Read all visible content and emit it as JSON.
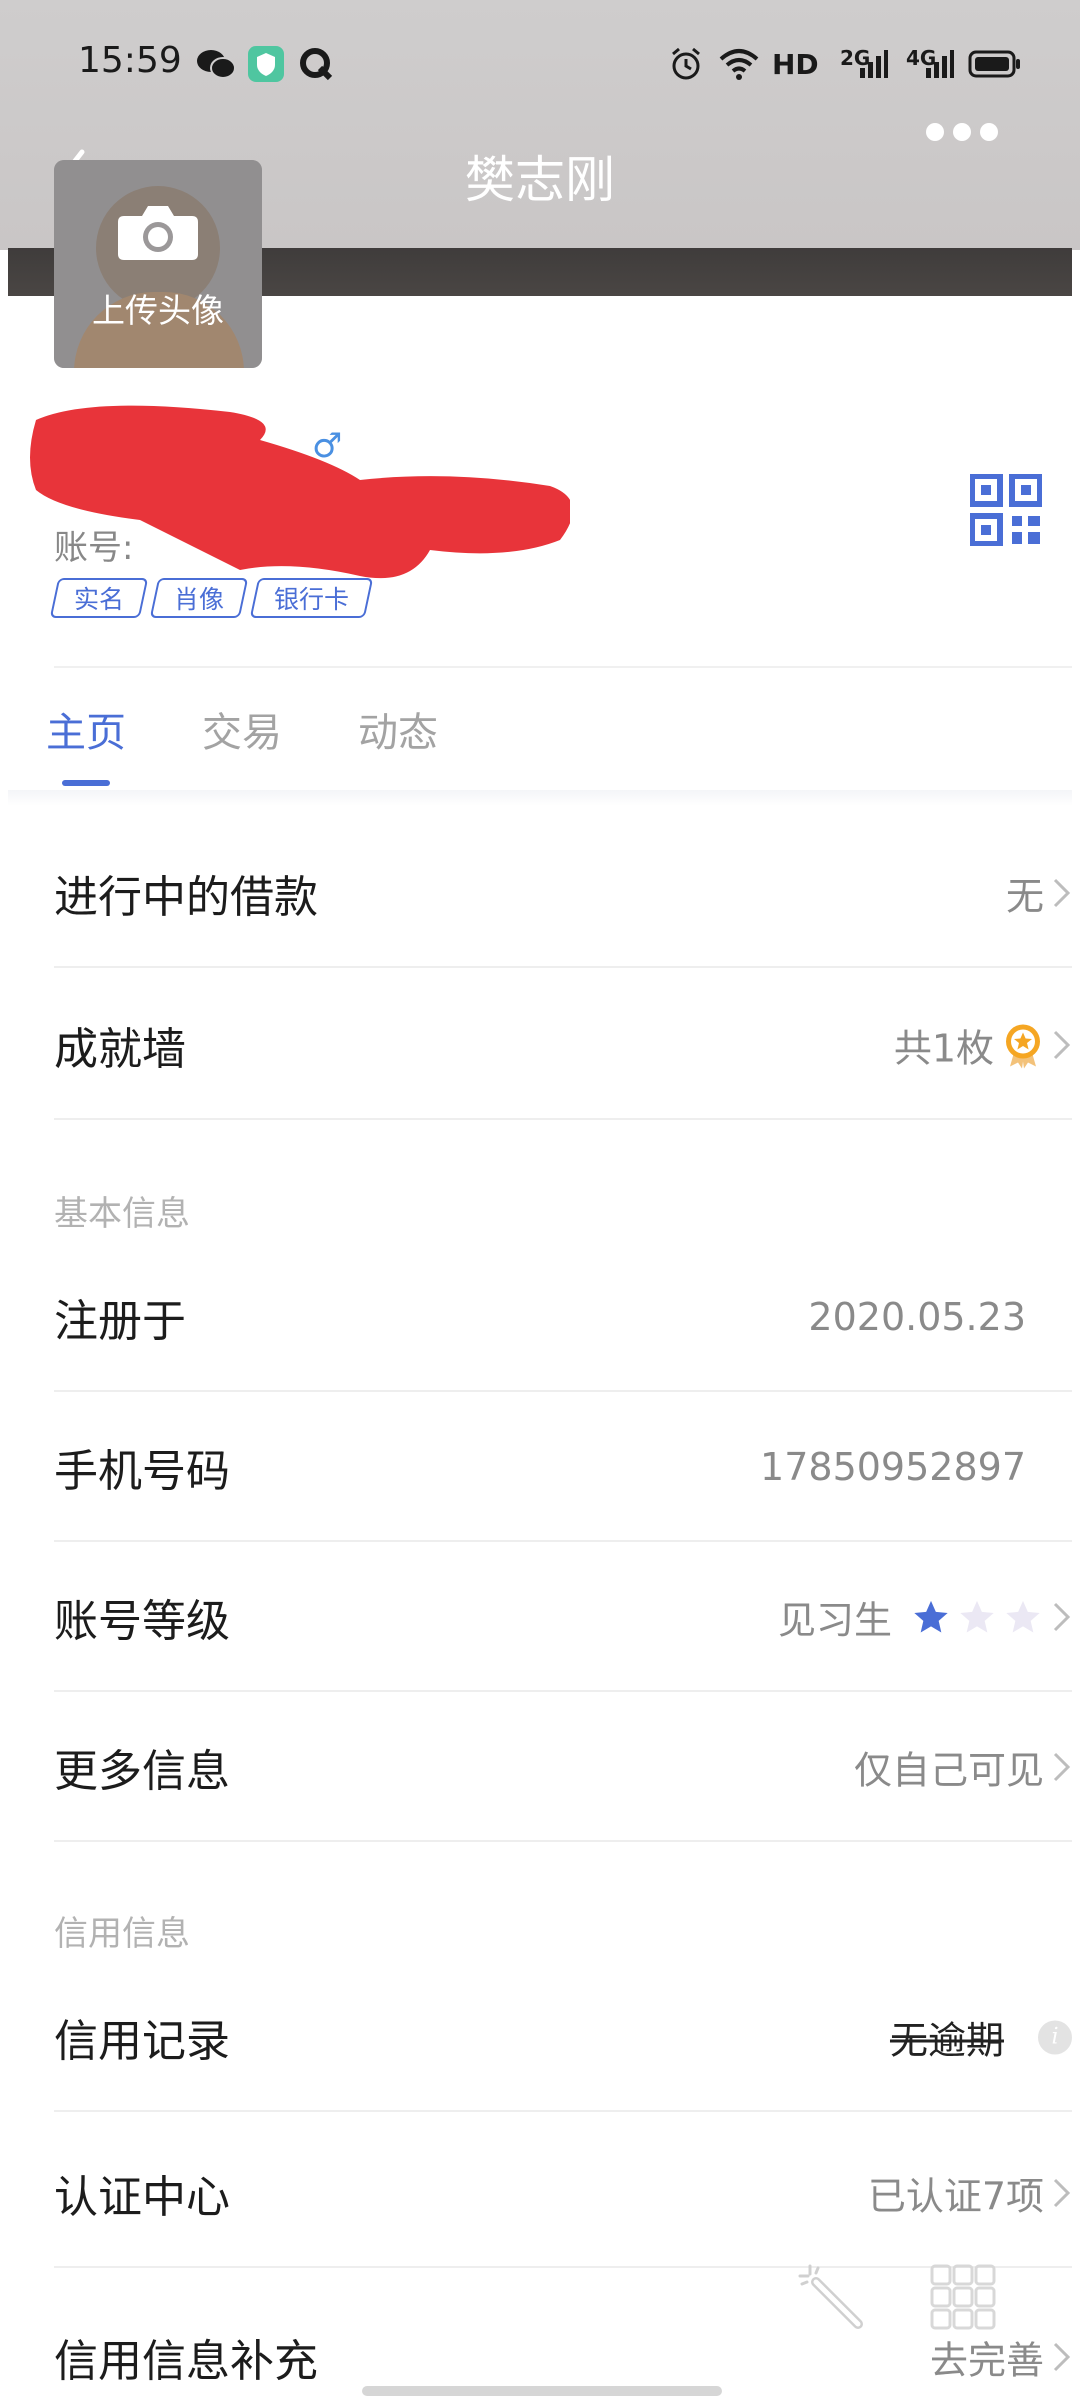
{
  "status_bar": {
    "time": "15:59",
    "network": "HD",
    "signal_1": "2G",
    "signal_2": "4G"
  },
  "header": {
    "title": "樊志刚"
  },
  "profile": {
    "upload_avatar_label": "上传头像",
    "account_label": "账号:",
    "tags": [
      "实名",
      "肖像",
      "银行卡"
    ]
  },
  "tabs": [
    {
      "label": "主页",
      "active": true
    },
    {
      "label": "交易",
      "active": false
    },
    {
      "label": "动态",
      "active": false
    }
  ],
  "rows_top": {
    "loans": {
      "label": "进行中的借款",
      "value": "无"
    },
    "achievements": {
      "label": "成就墙",
      "value": "共1枚"
    }
  },
  "basic_info": {
    "section_title": "基本信息",
    "registered": {
      "label": "注册于",
      "value": "2020.05.23"
    },
    "phone": {
      "label": "手机号码",
      "value": "17850952897"
    },
    "level": {
      "label": "账号等级",
      "value": "见习生",
      "stars_filled": 1,
      "stars_total": 3
    },
    "more": {
      "label": "更多信息",
      "value": "仅自己可见"
    }
  },
  "credit_info": {
    "section_title": "信用信息",
    "record": {
      "label": "信用记录",
      "value": "无逾期"
    },
    "certification": {
      "label": "认证中心",
      "value": "已认证7项"
    },
    "supplement": {
      "label": "信用信息补充",
      "value": "去完善"
    }
  },
  "colors": {
    "accent": "#4a6ed6",
    "redaction": "#e8343a",
    "medal": "#f5a623"
  }
}
